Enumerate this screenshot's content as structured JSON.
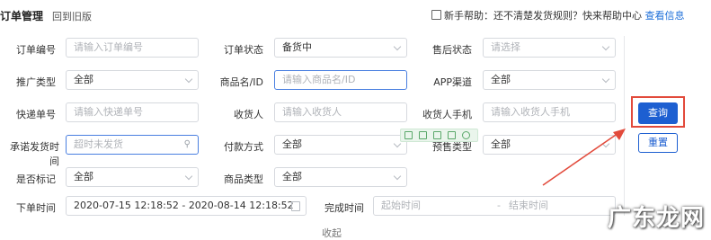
{
  "header": {
    "title": "订单管理",
    "back_link": "回到旧版",
    "help_prefix": "新手帮助：还不清楚发货规则？快来帮助中心",
    "help_link": "查看信息"
  },
  "form": {
    "order_no": {
      "label": "订单编号",
      "placeholder": "请输入订单编号"
    },
    "order_status": {
      "label": "订单状态",
      "value": "备货中"
    },
    "after_sale": {
      "label": "售后状态",
      "placeholder": "请选择"
    },
    "promo_type": {
      "label": "推广类型",
      "value": "全部"
    },
    "product_name": {
      "label": "商品名/ID",
      "placeholder": "请输入商品名/ID"
    },
    "app_channel": {
      "label": "APP渠道",
      "value": "全部"
    },
    "tracking_no": {
      "label": "快递单号",
      "placeholder": "请输入快递单号"
    },
    "receiver": {
      "label": "收货人",
      "placeholder": "请输入收货人"
    },
    "receiver_phone": {
      "label": "收货人手机",
      "placeholder": "请输入收货人手机"
    },
    "promised_ship": {
      "label": "承诺发货时间",
      "placeholder": "超时未发货"
    },
    "payment": {
      "label": "付款方式",
      "value": "全部"
    },
    "presale_type": {
      "label": "预售类型",
      "value": "全部"
    },
    "marked": {
      "label": "是否标记",
      "value": "全部"
    },
    "product_type": {
      "label": "商品类型",
      "value": "全部"
    },
    "order_time": {
      "label": "下单时间",
      "start": "2020-07-15 12:18:52",
      "sep": "-",
      "end": "2020-08-14 12:18:52"
    },
    "finish_time": {
      "label": "完成时间",
      "start_placeholder": "起始时间",
      "sep": "-",
      "end_placeholder": "结束时间"
    }
  },
  "buttons": {
    "query": "查询",
    "reset": "重置"
  },
  "collapse": "收起",
  "watermark": "广东龙网",
  "colors": {
    "primary": "#1d5fd1",
    "highlight": "#e24a3b"
  }
}
